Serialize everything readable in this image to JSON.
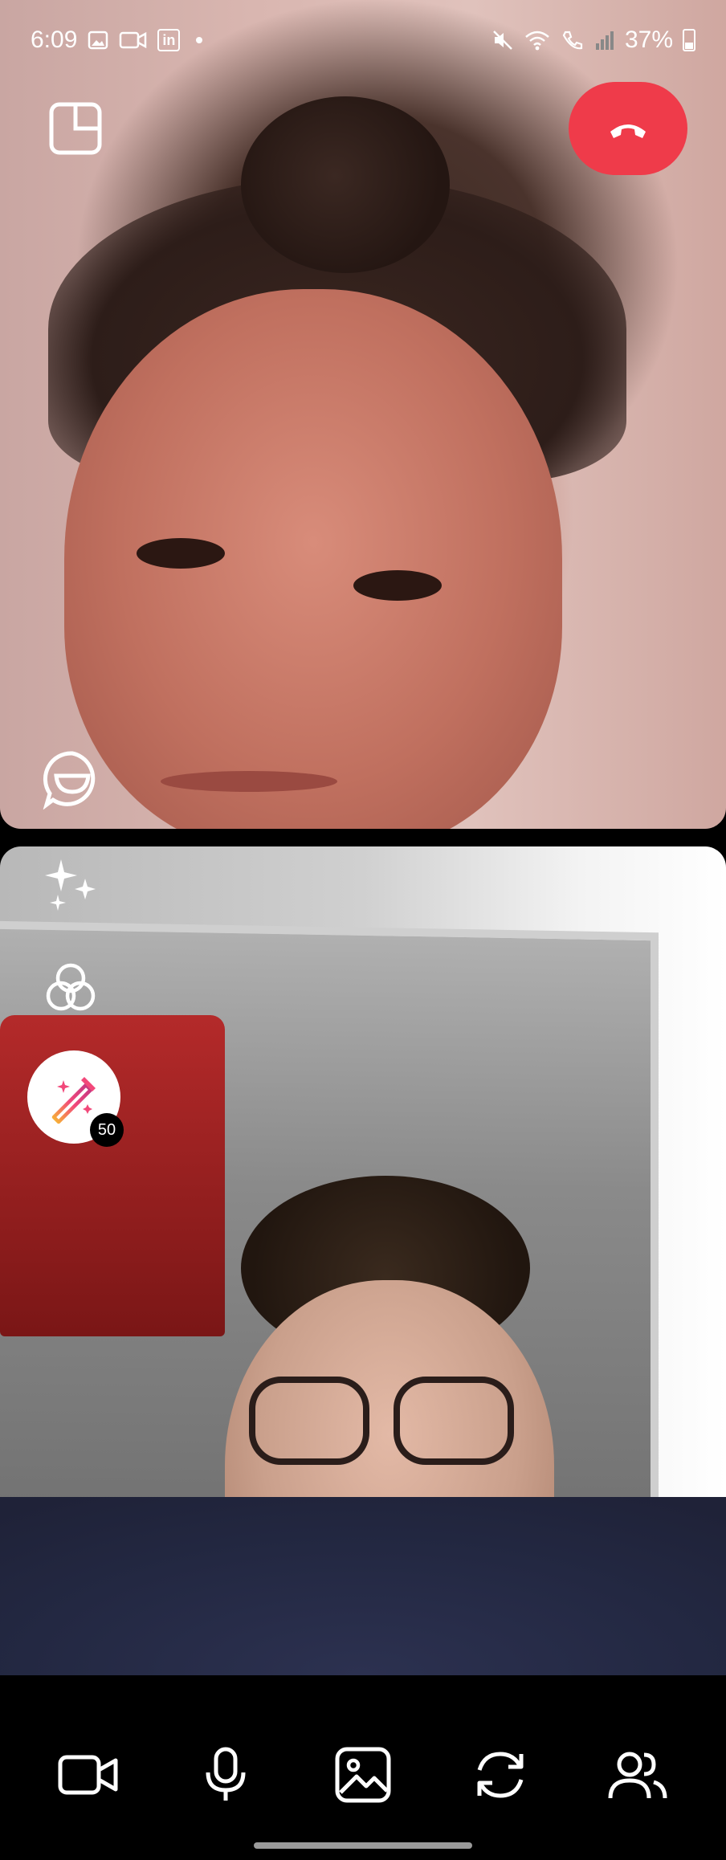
{
  "status_bar": {
    "time": "6:09",
    "left_icons": [
      "image-icon",
      "video-icon",
      "linkedin-icon",
      "dot"
    ],
    "right_icons": [
      "mute-icon",
      "wifi-icon",
      "call-icon",
      "signal-icon"
    ],
    "battery_percent": "37%",
    "linkedin_label": "in"
  },
  "call": {
    "end_call_color": "#ef3b4a",
    "effect_badge": "50"
  },
  "controls": [
    {
      "name": "camera-toggle",
      "icon": "video-icon"
    },
    {
      "name": "mic-toggle",
      "icon": "microphone-icon"
    },
    {
      "name": "share-media",
      "icon": "image-icon"
    },
    {
      "name": "flip-camera",
      "icon": "switch-camera-icon"
    },
    {
      "name": "participants",
      "icon": "people-icon"
    }
  ]
}
